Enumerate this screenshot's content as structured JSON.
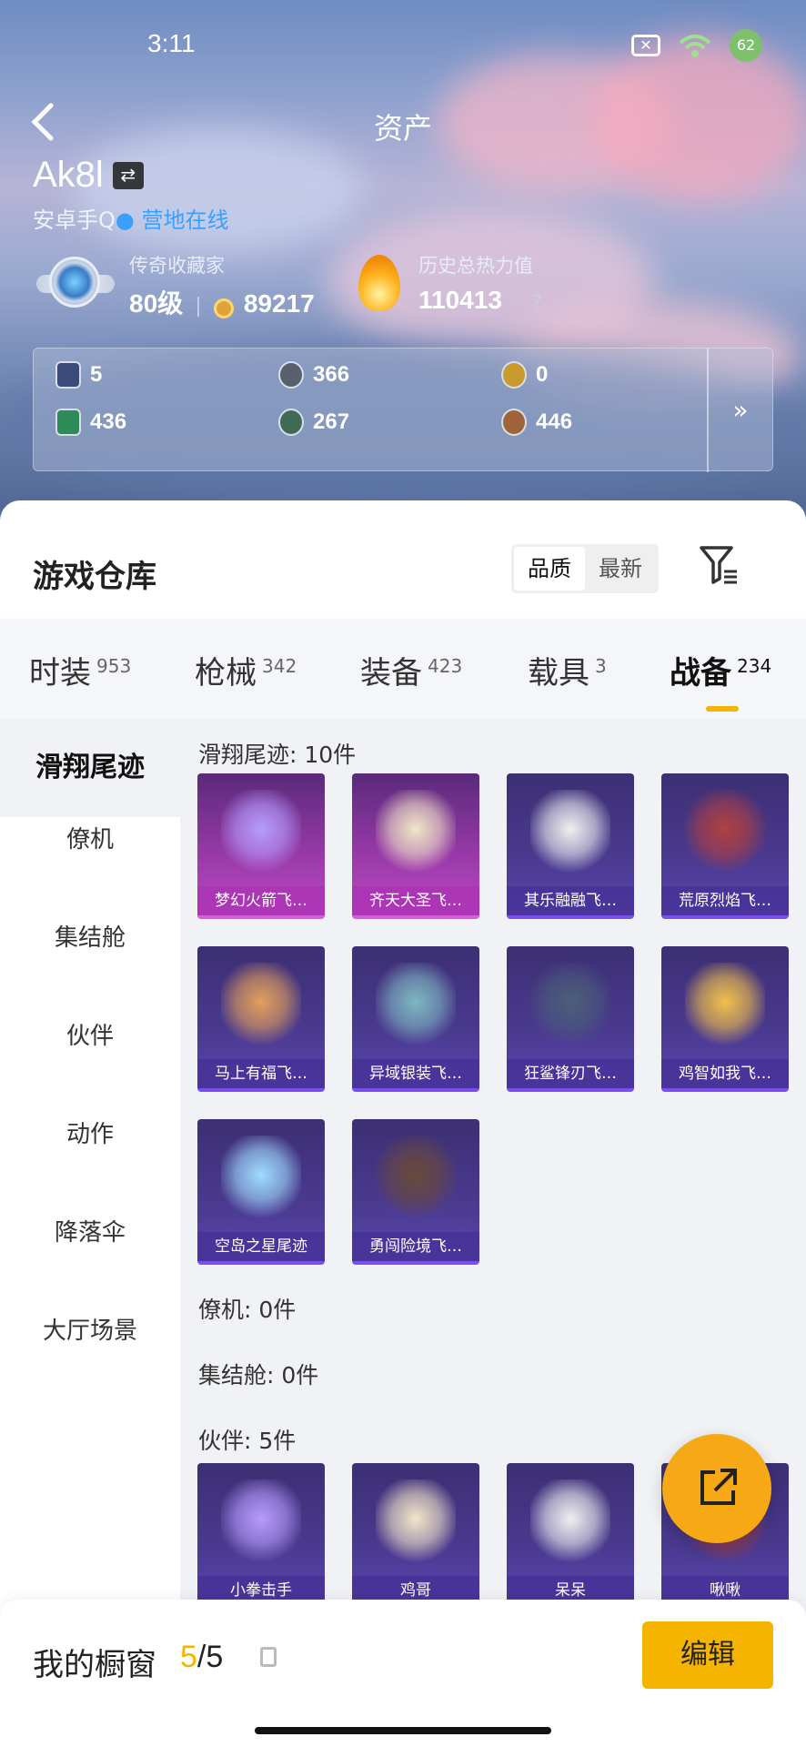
{
  "status_bar": {
    "time": "3:11",
    "battery": "62"
  },
  "nav": {
    "title": "资产"
  },
  "profile": {
    "username": "Ak8l",
    "swap_icon": "⇄",
    "platform": "安卓手Q",
    "online_text": "营地在线",
    "rank_label": "传奇收藏家",
    "level": "80级",
    "points": "89217",
    "heat_label": "历史总热力值",
    "heat_value": "110413",
    "help": "?"
  },
  "currencies": [
    {
      "icon": "card-icon",
      "value": "5",
      "color": "#3a4b7a"
    },
    {
      "icon": "silver-coin-icon",
      "value": "366",
      "color": "#58606e"
    },
    {
      "icon": "gold-coin-icon",
      "value": "0",
      "color": "#c99a2e"
    },
    {
      "icon": "green-card-icon",
      "value": "436",
      "color": "#2f8a5a"
    },
    {
      "icon": "green-orb-icon",
      "value": "267",
      "color": "#3f6a55"
    },
    {
      "icon": "bronze-coin-icon",
      "value": "446",
      "color": "#a0643a"
    }
  ],
  "currency_more": "»",
  "warehouse": {
    "title": "游戏仓库",
    "sort_options": [
      "品质",
      "最新"
    ],
    "sort_selected": "品质"
  },
  "tabs": [
    {
      "label": "时装",
      "count": "953"
    },
    {
      "label": "枪械",
      "count": "342"
    },
    {
      "label": "装备",
      "count": "423"
    },
    {
      "label": "载具",
      "count": "3"
    },
    {
      "label": "战备",
      "count": "234"
    }
  ],
  "sidebar": [
    "滑翔尾迹",
    "僚机",
    "集结舱",
    "伙伴",
    "动作",
    "降落伞",
    "大厅场景"
  ],
  "sections": {
    "glide": {
      "label": "滑翔尾迹: 10件",
      "items": [
        "梦幻火箭飞…",
        "齐天大圣飞…",
        "其乐融融飞…",
        "荒原烈焰飞…",
        "马上有福飞…",
        "异域银装飞…",
        "狂鲨锋刃飞…",
        "鸡智如我飞…",
        "空岛之星尾迹",
        "勇闯险境飞…"
      ]
    },
    "wingman": {
      "label": "僚机: 0件"
    },
    "capsule": {
      "label": "集结舱: 0件"
    },
    "partner": {
      "label": "伙伴: 5件",
      "items": [
        "小拳击手",
        "鸡哥",
        "呆呆",
        "啾啾"
      ]
    }
  },
  "showcase": {
    "title": "我的橱窗",
    "current": "5",
    "total": "/5",
    "edit_label": "编辑"
  }
}
